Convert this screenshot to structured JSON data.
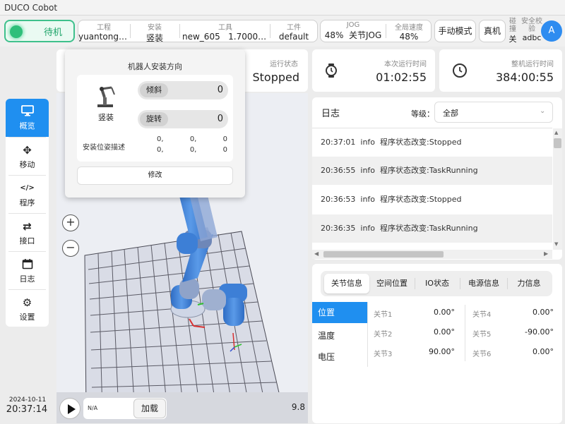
{
  "app_title": "DUCO Cobot",
  "status": {
    "label": "待机"
  },
  "top": {
    "project": {
      "label": "工程",
      "value": "yuantongda..."
    },
    "install": {
      "label": "安装",
      "value": "竖装"
    },
    "tool": {
      "label": "工具",
      "value": "new_605   1.700000..."
    },
    "workpiece": {
      "label": "工件",
      "value": "default"
    },
    "jog": {
      "label": "JOG",
      "percent": "48%",
      "mode": "关节JOG"
    },
    "global_speed": {
      "label": "全局速度",
      "value": "48%"
    },
    "manual_mode": "手动模式",
    "real_machine": "真机",
    "collision": {
      "label": "碰撞",
      "value": "关"
    },
    "safety_check": {
      "label": "安全校验",
      "value": "adbc"
    },
    "avatar": "A"
  },
  "popup": {
    "title": "机器人安装方向",
    "mount_label": "竖装",
    "tilt_label": "倾斜",
    "tilt_value": "0",
    "rotate_label": "旋转",
    "rotate_value": "0",
    "pose_label": "安装位姿描述",
    "pose_row1": [
      "0,",
      "0,",
      "0"
    ],
    "pose_row2": [
      "0,",
      "0,",
      "0"
    ],
    "modify_button": "修改"
  },
  "run_status": {
    "label": "运行状态",
    "value": "Stopped"
  },
  "run_time": {
    "label": "本次运行时间",
    "value": "01:02:55"
  },
  "total_time": {
    "label": "整机运行时间",
    "value": "384:00:55"
  },
  "sidebar": {
    "items": [
      {
        "label": "概览",
        "icon": "monitor-icon",
        "glyph": "🖥"
      },
      {
        "label": "移动",
        "icon": "move-icon",
        "glyph": "✥"
      },
      {
        "label": "程序",
        "icon": "code-icon",
        "glyph": "</>"
      },
      {
        "label": "接口",
        "icon": "interface-icon",
        "glyph": "⇄"
      },
      {
        "label": "日志",
        "icon": "calendar-icon",
        "glyph": "📅"
      },
      {
        "label": "设置",
        "icon": "gear-icon",
        "glyph": "⚙"
      }
    ]
  },
  "datetime": {
    "date": "2024-10-11",
    "time": "20:37:14"
  },
  "player": {
    "program": "N/A",
    "load_button": "加载",
    "fps": "9.8"
  },
  "log": {
    "title": "日志",
    "level_label": "等级：",
    "level_value": "全部",
    "entries": [
      {
        "time": "20:37:01",
        "level": "info",
        "message": "程序状态改变:Stopped"
      },
      {
        "time": "20:36:55",
        "level": "info",
        "message": "程序状态改变:TaskRunning"
      },
      {
        "time": "20:36:53",
        "level": "info",
        "message": "程序状态改变:Stopped"
      },
      {
        "time": "20:36:35",
        "level": "info",
        "message": "程序状态改变:TaskRunning"
      }
    ]
  },
  "info_tabs": [
    "关节信息",
    "空间位置",
    "IO状态",
    "电源信息",
    "力信息"
  ],
  "info_side": [
    "位置",
    "温度",
    "电压"
  ],
  "joints": [
    {
      "label": "关节1",
      "value": "0.00°"
    },
    {
      "label": "关节2",
      "value": "0.00°"
    },
    {
      "label": "关节3",
      "value": "90.00°"
    },
    {
      "label": "关节4",
      "value": "0.00°"
    },
    {
      "label": "关节5",
      "value": "-90.00°"
    },
    {
      "label": "关节6",
      "value": "0.00°"
    }
  ],
  "colors": {
    "accent": "#1f8ff0",
    "status_green": "#2fbf7a",
    "robot_blue": "#3d7fd6"
  }
}
